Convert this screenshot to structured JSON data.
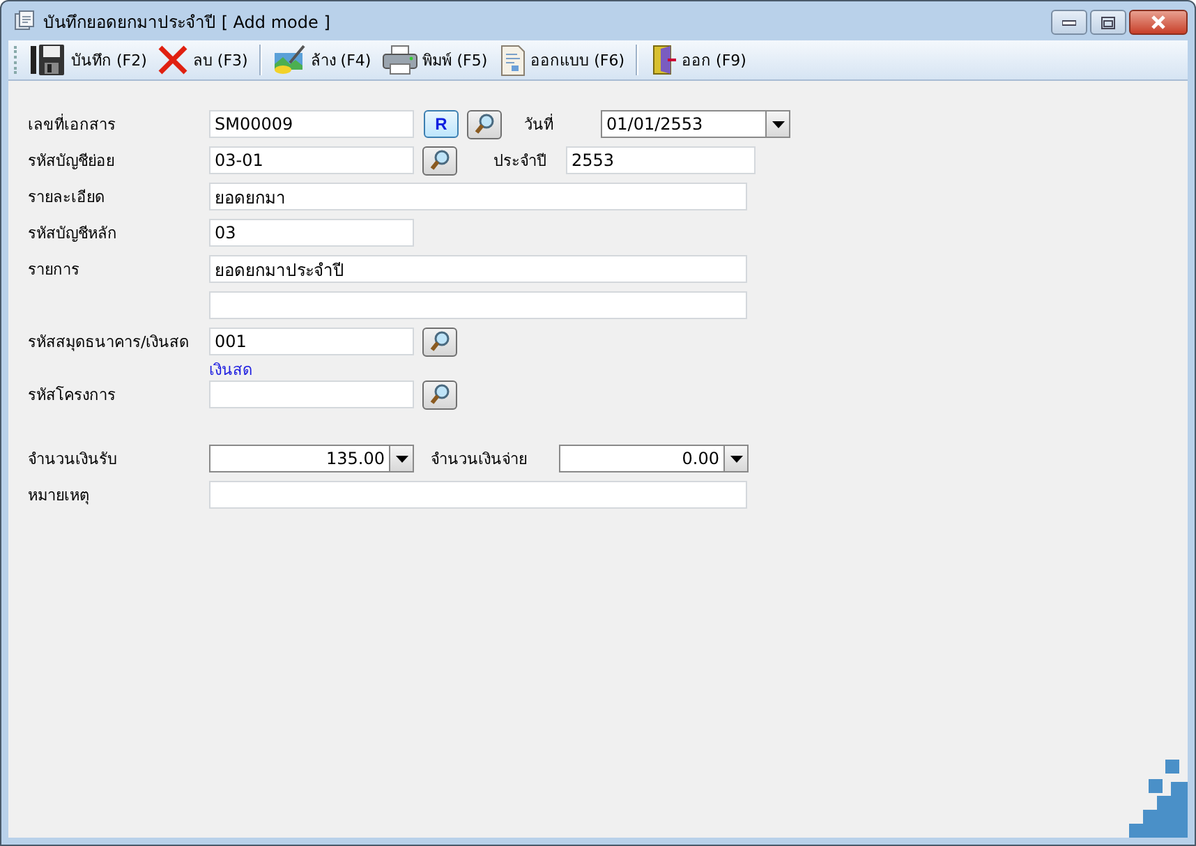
{
  "window": {
    "title": "บันทึกยอดยกมาประจำปี [ Add mode ]"
  },
  "toolbar": [
    [
      {
        "kind": "save",
        "label": "บันทึก (F2)"
      },
      {
        "kind": "delete",
        "label": "ลบ (F3)"
      }
    ],
    [
      {
        "kind": "clear",
        "label": "ล้าง (F4)"
      },
      {
        "kind": "print",
        "label": "พิมพ์ (F5)"
      },
      {
        "kind": "design",
        "label": "ออกแบบ (F6)"
      }
    ],
    [
      {
        "kind": "exit",
        "label": "ออก (F9)"
      }
    ]
  ],
  "form": {
    "doc_no": {
      "label": "เลขที่เอกสาร",
      "value": "SM00009",
      "run_button": "R"
    },
    "date": {
      "label": "วันที่",
      "value": "01/01/2553"
    },
    "sub_account": {
      "label": "รหัสบัญชีย่อย",
      "value": "03-01"
    },
    "year": {
      "label": "ประจำปี",
      "value": "2553"
    },
    "detail": {
      "label": "รายละเอียด",
      "value": "ยอดยกมา"
    },
    "main_account": {
      "label": "รหัสบัญชีหลัก",
      "value": "03"
    },
    "description": {
      "label": "รายการ",
      "value": "ยอดยกมาประจำปี"
    },
    "bank": {
      "label": "รหัสสมุดธนาคาร/เงินสด",
      "value": "001",
      "name": "เงินสด"
    },
    "project": {
      "label": "รหัสโครงการ"
    },
    "receive": {
      "label": "จำนวนเงินรับ",
      "value": "135.00"
    },
    "pay": {
      "label": "จำนวนเงินจ่าย",
      "value": "0.00"
    },
    "note": {
      "label": "หมายเหตุ"
    }
  }
}
